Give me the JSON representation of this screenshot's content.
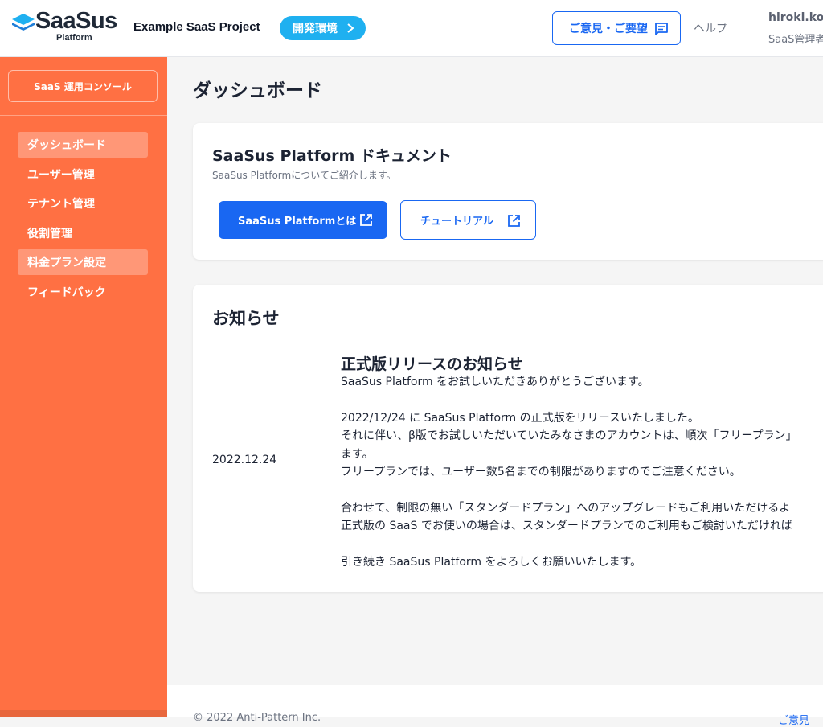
{
  "header": {
    "logo_text": "SaaSus",
    "logo_sub": "Platform",
    "project_name": "Example SaaS Project",
    "env_badge": "開発環境",
    "feedback_label": "ご意見・ご要望",
    "help_label": "ヘルプ",
    "user_name": "hiroki.koc",
    "user_role": "SaaS管理者"
  },
  "sidebar": {
    "console_label": "SaaS 運用コンソール",
    "items": [
      {
        "label": "ダッシュボード",
        "active": true
      },
      {
        "label": "ユーザー管理",
        "active": false
      },
      {
        "label": "テナント管理",
        "active": false
      },
      {
        "label": "役割管理",
        "active": false
      },
      {
        "label": "料金プラン設定",
        "active": true
      },
      {
        "label": "フィードバック",
        "active": false
      }
    ]
  },
  "main": {
    "page_title": "ダッシュボード",
    "docs": {
      "title": "SaaSus Platform ドキュメント",
      "subtitle": "SaaSus Platformについてご紹介します。",
      "primary_button": "SaaSus Platformとは",
      "secondary_button": "チュートリアル"
    },
    "news": {
      "heading": "お知らせ",
      "date": "2022.12.24",
      "title": "正式版リリースのお知らせ",
      "body": [
        "SaaSus Platform をお試しいただきありがとうございます。",
        "",
        "2022/12/24 に SaaSus Platform の正式版をリリースいたしました。",
        "それに伴い、β版でお試しいただいていたみなさまのアカウントは、順次「フリープラン」",
        "ます。",
        "フリープランでは、ユーザー数5名までの制限がありますのでご注意ください。",
        "",
        "合わせて、制限の無い「スタンダードプラン」へのアップグレードもご利用いただけるよ",
        "正式版の SaaS でお使いの場合は、スタンダードプランでのご利用もご検討いただければ",
        "",
        "引き続き SaaSus Platform をよろしくお願いいたします。"
      ]
    }
  },
  "footer": {
    "copyright": "© 2022 Anti-Pattern Inc.",
    "link": "ご意見"
  },
  "colors": {
    "sidebar": "#ff7043",
    "primary": "#1967f2",
    "env_badge": "#1fb0f0"
  }
}
